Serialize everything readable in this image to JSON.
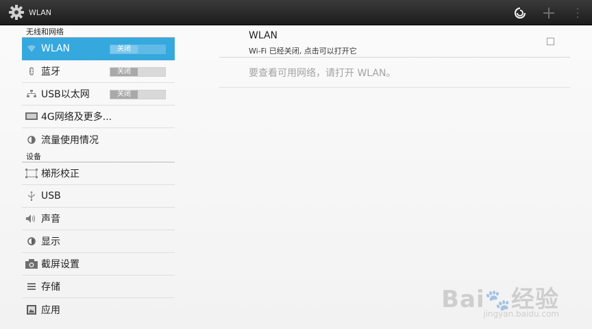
{
  "actionbar": {
    "title": "WLAN",
    "icons": {
      "app": "settings-gear-icon",
      "wps": "wps-icon",
      "add": "add-icon",
      "overflow": "overflow-menu-icon"
    }
  },
  "sections": {
    "wireless": "无线和网络",
    "device": "设备"
  },
  "nav": {
    "wlan": {
      "label": "WLAN",
      "toggle": "关闭",
      "icon": "wifi-icon"
    },
    "bluetooth": {
      "label": "蓝牙",
      "toggle": "关闭",
      "icon": "bluetooth-icon"
    },
    "ethernet": {
      "label": "USB以太网",
      "toggle": "关闭",
      "icon": "ethernet-icon"
    },
    "more": {
      "label": "4G网络及更多...",
      "icon": "network-more-icon"
    },
    "data_usage": {
      "label": "流量使用情况",
      "icon": "data-usage-icon"
    },
    "keystone": {
      "label": "梯形校正",
      "icon": "keystone-icon"
    },
    "usb": {
      "label": "USB",
      "icon": "usb-icon"
    },
    "sound": {
      "label": "声音",
      "icon": "volume-icon"
    },
    "display": {
      "label": "显示",
      "icon": "brightness-icon"
    },
    "screenshot": {
      "label": "截屏设置",
      "icon": "camera-icon"
    },
    "storage": {
      "label": "存储",
      "icon": "storage-icon"
    },
    "apps": {
      "label": "应用",
      "icon": "apps-icon"
    }
  },
  "detail": {
    "wlan_title": "WLAN",
    "wlan_summary": "Wi-Fi 已经关闭, 点击可以打开它",
    "wlan_checked": false,
    "empty_message": "要查看可用网络，请打开 WLAN。"
  },
  "colors": {
    "accent": "#35a8de",
    "actionbar": "#2b2b2b"
  },
  "watermark": {
    "brand": "Bai 经验",
    "url": "jingyan.baidu.com"
  }
}
